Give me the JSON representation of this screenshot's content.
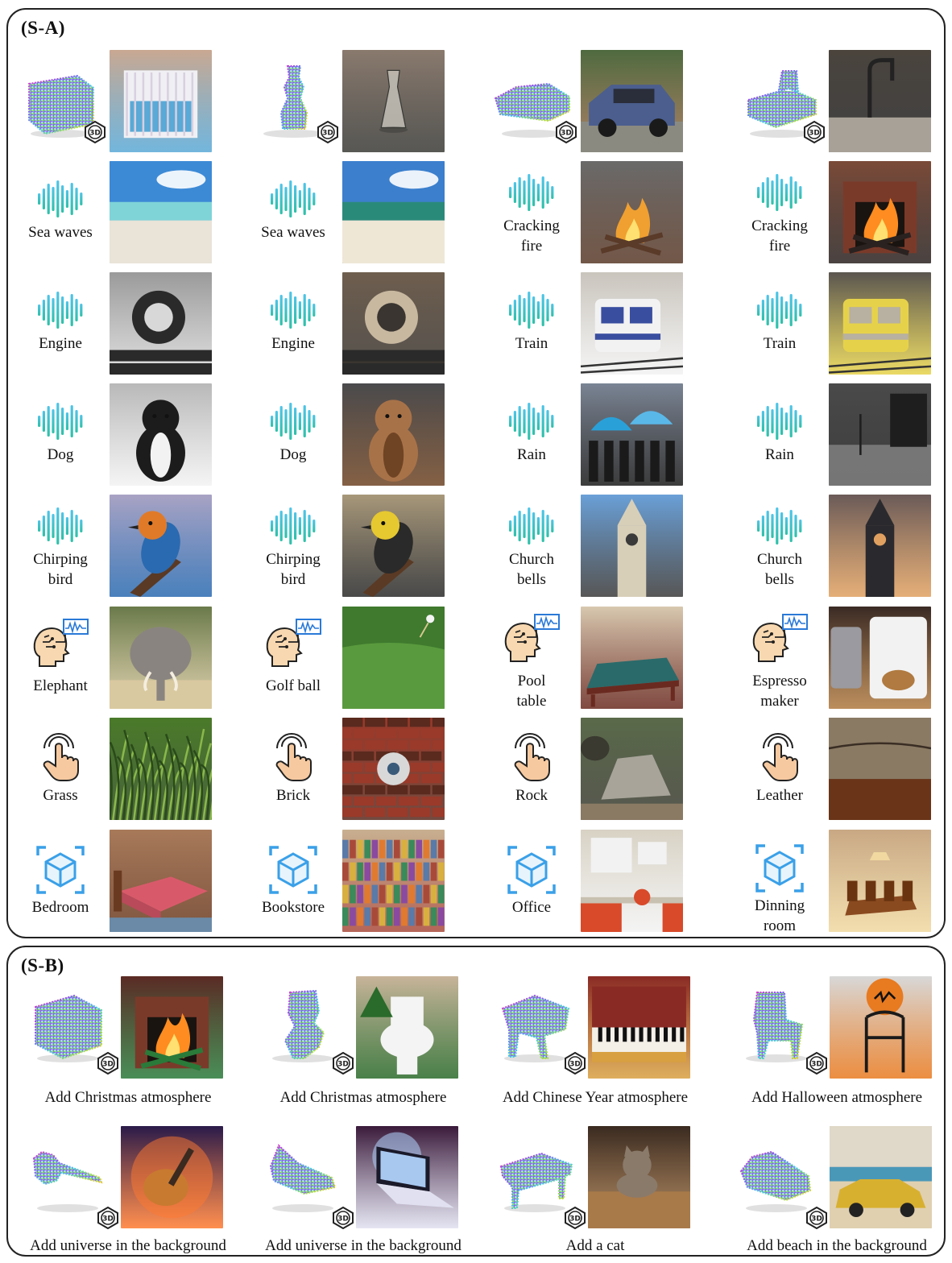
{
  "panel_a": {
    "title": "(S-A)",
    "rows": [
      {
        "kind": "3d",
        "items": [
          {
            "label": "",
            "photo": {
              "bg": "#c9a892",
              "fg": "#f0f0f4",
              "accent": "#5aa9d6",
              "motif": "crib"
            },
            "cloud": "crib"
          },
          {
            "label": "",
            "photo": {
              "bg": "#8a7a6e",
              "fg": "#c9c5bd",
              "accent": "#3a3a36",
              "motif": "vase"
            },
            "cloud": "vase"
          },
          {
            "label": "",
            "photo": {
              "bg": "#4f6a3f",
              "fg": "#4b5e8e",
              "accent": "#9a6b4b",
              "motif": "car"
            },
            "cloud": "car"
          },
          {
            "label": "",
            "photo": {
              "bg": "#4a443d",
              "fg": "#a8a198",
              "accent": "#222222",
              "motif": "sink"
            },
            "cloud": "sink"
          }
        ]
      },
      {
        "kind": "audio",
        "items": [
          {
            "label": "Sea waves",
            "photo": {
              "bg": "#3c8ad6",
              "fg": "#e9e3d8",
              "accent": "#7fd4d8",
              "motif": "beach"
            }
          },
          {
            "label": "Sea waves",
            "photo": {
              "bg": "#3b7fcd",
              "fg": "#efe7d6",
              "accent": "#2a8a7a",
              "motif": "beach"
            }
          },
          {
            "label": "Cracking\nfire",
            "photo": {
              "bg": "#6a6a6a",
              "fg": "#f0a030",
              "accent": "#5a3a28",
              "motif": "fire"
            }
          },
          {
            "label": "Cracking\nfire",
            "photo": {
              "bg": "#7a4a38",
              "fg": "#ff8c20",
              "accent": "#2a2220",
              "motif": "fireplace"
            }
          }
        ]
      },
      {
        "kind": "audio",
        "items": [
          {
            "label": "Engine",
            "photo": {
              "bg": "#9a9a9a",
              "fg": "#2a2a2a",
              "accent": "#d8d8d8",
              "motif": "locomotive"
            }
          },
          {
            "label": "Engine",
            "photo": {
              "bg": "#6e5e4e",
              "fg": "#c8b8a0",
              "accent": "#3a3530",
              "motif": "machine"
            }
          },
          {
            "label": "Train",
            "photo": {
              "bg": "#c9c4bc",
              "fg": "#3a4ea0",
              "accent": "#f2f2f2",
              "motif": "train"
            }
          },
          {
            "label": "Train",
            "photo": {
              "bg": "#5a5550",
              "fg": "#b8b0a0",
              "accent": "#e6d24a",
              "motif": "train"
            }
          }
        ]
      },
      {
        "kind": "audio",
        "items": [
          {
            "label": "Dog",
            "photo": {
              "bg": "#b8b8b8",
              "fg": "#1c1c1c",
              "accent": "#f2f2f2",
              "motif": "dog"
            }
          },
          {
            "label": "Dog",
            "photo": {
              "bg": "#4a4a4c",
              "fg": "#a87248",
              "accent": "#6e4424",
              "motif": "dog"
            }
          },
          {
            "label": "Rain",
            "photo": {
              "bg": "#7a8494",
              "fg": "#2aa0d8",
              "accent": "#1a1a1a",
              "motif": "umbrella"
            }
          },
          {
            "label": "Rain",
            "photo": {
              "bg": "#4a4a4a",
              "fg": "#9a9a9a",
              "accent": "#1e1e1e",
              "motif": "street"
            }
          }
        ]
      },
      {
        "kind": "audio",
        "items": [
          {
            "label": "Chirping\nbird",
            "photo": {
              "bg": "#a9a3c4",
              "fg": "#e07a28",
              "accent": "#2a6ab0",
              "motif": "bird"
            }
          },
          {
            "label": "Chirping\nbird",
            "photo": {
              "bg": "#a8987a",
              "fg": "#e6c830",
              "accent": "#2a2a2a",
              "motif": "bird"
            }
          },
          {
            "label": "Church\nbells",
            "photo": {
              "bg": "#6aa0d8",
              "fg": "#d8cfb8",
              "accent": "#3a3a3a",
              "motif": "tower"
            }
          },
          {
            "label": "Church\nbells",
            "photo": {
              "bg": "#6a5a58",
              "fg": "#2a2a2e",
              "accent": "#e0a060",
              "motif": "tower"
            }
          }
        ]
      },
      {
        "kind": "fmri",
        "items": [
          {
            "label": "Elephant",
            "photo": {
              "bg": "#6a7a4a",
              "fg": "#8a8480",
              "accent": "#d9c9a0",
              "motif": "elephant"
            }
          },
          {
            "label": "Golf ball",
            "photo": {
              "bg": "#3f7a2e",
              "fg": "#5a9a3e",
              "accent": "#f4f4f4",
              "motif": "golf"
            }
          },
          {
            "label": "Pool\ntable",
            "photo": {
              "bg": "#d8c8b0",
              "fg": "#2a6a6a",
              "accent": "#6a2a20",
              "motif": "pool"
            }
          },
          {
            "label": "Espresso\nmaker",
            "photo": {
              "bg": "#3a2a24",
              "fg": "#f2f2f2",
              "accent": "#b07a40",
              "motif": "coffee"
            }
          }
        ]
      },
      {
        "kind": "touch",
        "items": [
          {
            "label": "Grass",
            "photo": {
              "bg": "#4a7a2a",
              "fg": "#8ab84a",
              "accent": "#2a4a1a",
              "motif": "grass"
            }
          },
          {
            "label": "Brick",
            "photo": {
              "bg": "#9a3a2a",
              "fg": "#d8d8d8",
              "accent": "#5a2a1e",
              "motif": "brick"
            }
          },
          {
            "label": "Rock",
            "photo": {
              "bg": "#5a6a4a",
              "fg": "#a8a49a",
              "accent": "#3a3a30",
              "motif": "rock"
            }
          },
          {
            "label": "Leather",
            "photo": {
              "bg": "#3a2e24",
              "fg": "#8a7a64",
              "accent": "#6a3418",
              "motif": "leather"
            }
          }
        ]
      },
      {
        "kind": "scene",
        "items": [
          {
            "label": "Bedroom",
            "photo": {
              "bg": "#a87a5a",
              "fg": "#d85a6a",
              "accent": "#6a3a20",
              "motif": "bed"
            }
          },
          {
            "label": "Bookstore",
            "photo": {
              "bg": "#c8b090",
              "fg": "#5a7aa8",
              "accent": "#a84a3a",
              "motif": "books"
            }
          },
          {
            "label": "Office",
            "photo": {
              "bg": "#d8d2c4",
              "fg": "#d84a2a",
              "accent": "#f2f2f2",
              "motif": "office"
            }
          },
          {
            "label": "Dinning\nroom",
            "photo": {
              "bg": "#c8a884",
              "fg": "#8a4a20",
              "accent": "#f0d8a0",
              "motif": "dining"
            }
          }
        ]
      }
    ]
  },
  "panel_b": {
    "title": "(S-B)",
    "rows": [
      [
        {
          "caption": "Add Christmas atmosphere",
          "cloud": "box",
          "photo": {
            "bg": "#5a2a24",
            "fg": "#ff8c20",
            "accent": "#2a7a3a",
            "motif": "fireplace"
          }
        },
        {
          "caption": "Add Christmas atmosphere",
          "cloud": "toilet",
          "photo": {
            "bg": "#c8b49a",
            "fg": "#f4f4f4",
            "accent": "#2a6a2a",
            "motif": "toilet"
          }
        },
        {
          "caption": "Add Chinese Year atmosphere",
          "cloud": "piano",
          "photo": {
            "bg": "#8a2a24",
            "fg": "#f4f0e8",
            "accent": "#d8a040",
            "motif": "piano"
          }
        },
        {
          "caption": "Add Halloween atmosphere",
          "cloud": "chair",
          "photo": {
            "bg": "#d8d8d8",
            "fg": "#1a1a1a",
            "accent": "#e87a20",
            "motif": "halloween"
          }
        }
      ],
      [
        {
          "caption": "Add universe in the background",
          "cloud": "guitar",
          "photo": {
            "bg": "#2a1a4a",
            "fg": "#c87a30",
            "accent": "#ff7a30",
            "motif": "guitar"
          }
        },
        {
          "caption": "Add universe in the background",
          "cloud": "laptop",
          "photo": {
            "bg": "#3a1a3a",
            "fg": "#a8c8f0",
            "accent": "#e0e0f0",
            "motif": "laptop"
          }
        },
        {
          "caption": "Add a cat",
          "cloud": "bench",
          "photo": {
            "bg": "#3a2a20",
            "fg": "#8a7a6a",
            "accent": "#a87a4a",
            "motif": "cat"
          }
        },
        {
          "caption": "Add beach in the background",
          "cloud": "sofa",
          "photo": {
            "bg": "#8a98a0",
            "fg": "#d8b030",
            "accent": "#e0d0b0",
            "motif": "taxi"
          }
        }
      ]
    ]
  },
  "icons": {
    "3d": "point-cloud-icon",
    "audio": "audio-wave-icon",
    "fmri": "brain-signal-icon",
    "touch": "touch-icon",
    "scene": "3d-scene-icon",
    "badge": "3d-badge-icon"
  },
  "colors": {
    "wave_top": "#4fc4e8",
    "wave_bottom": "#2fc0a8",
    "scene_blue": "#3aa0e8",
    "head_skin": "#f8d8b0"
  }
}
